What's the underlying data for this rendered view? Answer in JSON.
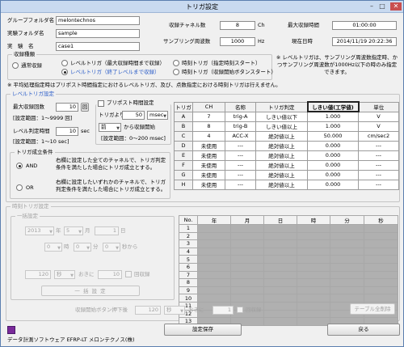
{
  "window": {
    "title": "トリガ設定",
    "min": "–",
    "max": "□",
    "close": "✕"
  },
  "info": {
    "group_folder_label": "グループフォルダ名",
    "group_folder": "melontechnos",
    "exp_folder_label": "実験フォルダ名",
    "exp_folder": "sample",
    "exp_name_label": "実　験　名",
    "exp_name": "case1",
    "channels_label": "収録チャネル数",
    "channels": "8",
    "channels_unit": "Ch",
    "rate_label": "サンプリング周波数",
    "rate": "1000",
    "rate_unit": "Hz",
    "max_time_label": "最大収録時間",
    "max_time": "01:00:00",
    "now_label": "現在日時",
    "now": "2014/11/19 20:22:36"
  },
  "mode": {
    "title": "収録種類",
    "options": [
      "通常収録",
      "レベルトリガ（最大収録時間まで収録）",
      "時刻トリガ（指定時刻スタート）",
      "レベルトリガ（終了レベルまで収録）",
      "時刻トリガ（収録開始ボタンスタート）"
    ],
    "note": "※ レベルトリガは、サンプリング周波数指定時、かつサンプリング周波数が1000Hz以下の時のみ指定できます。"
  },
  "warning": "※ 平均処理指定時はプリポスト時間指定におけるレベルトリガ、及び、点数指定における時刻トリガは行えません。",
  "level": {
    "title": "レベルトリガ設定",
    "max_count_label": "最大収録回数",
    "max_count": "10",
    "max_count_btn": "回",
    "max_count_range": "[設定範囲：1～9999 回]",
    "level_time_label": "レベル判定時間",
    "level_time": "10",
    "level_time_unit": "sec",
    "level_time_range": "[設定範囲：1～10 sec]",
    "prepost_label": "プリポスト時間設定",
    "trig_from_label": "トリガより",
    "trig_from": "50",
    "trig_unit": "msec",
    "before": "前",
    "start_label": "から収録開始",
    "prepost_range": "[設定範囲：0～200 msec]",
    "cond_title": "トリガ成立条件",
    "and_label": "AND",
    "and_text": "右欄に設定した全てのチャネルで、トリガ判定条件を満たした場合にトリガ成立とする。",
    "or_label": "OR",
    "or_text": "右欄に設定したいずれかのチャネルで、トリガ判定条件を満たした場合にトリガ成立とする。"
  },
  "trig_table": {
    "headers": [
      "トリガ",
      "CH",
      "名称",
      "トリガ判定",
      "しきい値(工学値)",
      "単位"
    ],
    "rows": [
      [
        "A",
        "7",
        "trig-A",
        "しきい値以下",
        "1.000",
        "V"
      ],
      [
        "B",
        "8",
        "trig-B",
        "しきい値以上",
        "1.000",
        "V"
      ],
      [
        "C",
        "4",
        "ACC-X",
        "絶対値以上",
        "50.000",
        "cm/sec2"
      ],
      [
        "D",
        "未使用",
        "---",
        "絶対値以上",
        "0.000",
        "---"
      ],
      [
        "E",
        "未使用",
        "---",
        "絶対値以上",
        "0.000",
        "---"
      ],
      [
        "F",
        "未使用",
        "---",
        "絶対値以上",
        "0.000",
        "---"
      ],
      [
        "G",
        "未使用",
        "---",
        "絶対値以上",
        "0.000",
        "---"
      ],
      [
        "H",
        "未使用",
        "---",
        "絶対値以上",
        "0.000",
        "---"
      ]
    ]
  },
  "time": {
    "title": "時刻トリガ設定",
    "batch_title": "一括設定",
    "year": "2013",
    "year_unit": "年",
    "month": "5",
    "month_unit": "月",
    "day": "1",
    "day_unit": "日",
    "hour": "0",
    "hour_unit": "時",
    "min": "0",
    "min_unit": "分",
    "sec": "0",
    "sec_unit": "秒から",
    "interval": "120",
    "interval_unit": "秒",
    "every_label": "おきに",
    "count": "10",
    "count_unit": "回収録",
    "batch_btn": "一 括 設 定",
    "table_headers": [
      "No.",
      "年",
      "月",
      "日",
      "時",
      "分",
      "秒"
    ],
    "table_rows": [
      "1",
      "2",
      "3",
      "4",
      "5",
      "6",
      "7",
      "8",
      "9",
      "10",
      "11",
      "12",
      "13"
    ],
    "btn_press_label": "収録開始ボタン押下後",
    "btn_interval": "120",
    "btn_unit": "秒",
    "btn_every": "おきに",
    "btn_count": "1",
    "btn_count_unit": "回収録",
    "clear_btn": "テーブル全削除"
  },
  "footer": {
    "save": "設定保存",
    "back": "戻る",
    "app": "データ計測ソフトウェア EFRP-LT メロンテクノス(株)"
  }
}
